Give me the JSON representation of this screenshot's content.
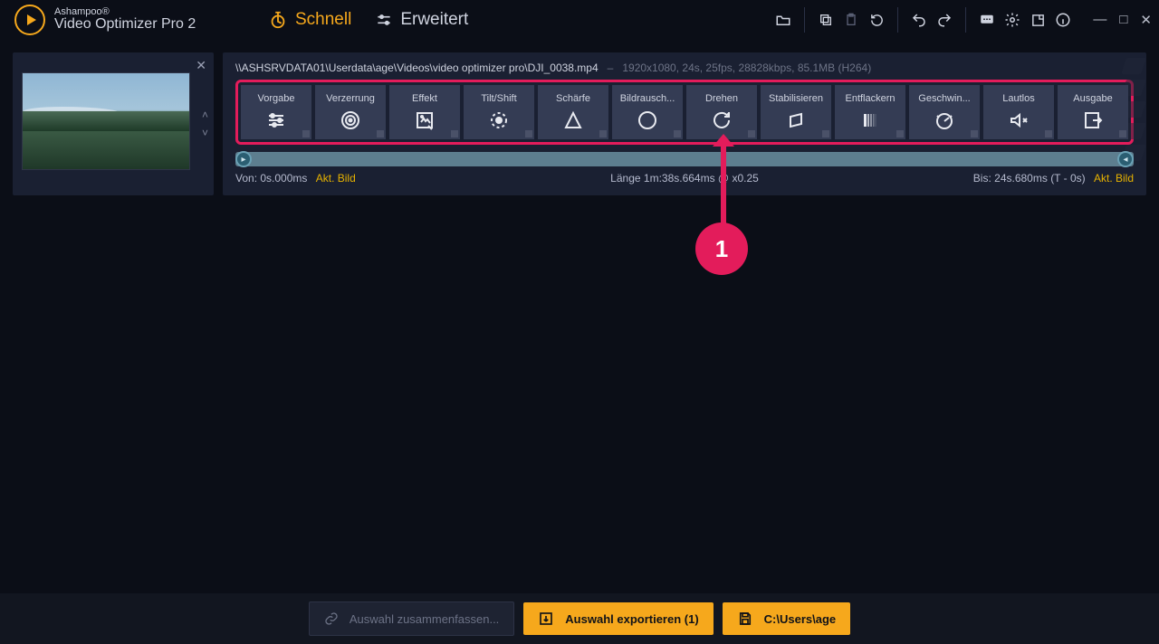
{
  "app": {
    "brand_small": "Ashampoo®",
    "brand_big": "Video Optimizer Pro 2"
  },
  "modes": {
    "fast": "Schnell",
    "advanced": "Erweitert"
  },
  "file": {
    "path": "\\\\ASHSRVDATA01\\Userdata\\age\\Videos\\video optimizer pro\\DJI_0038.mp4",
    "info": "1920x1080, 24s, 25fps, 28828kbps, 85.1MB (H264)"
  },
  "tools": [
    {
      "id": "vorgabe",
      "label": "Vorgabe"
    },
    {
      "id": "verzerrung",
      "label": "Verzerrung"
    },
    {
      "id": "effekt",
      "label": "Effekt"
    },
    {
      "id": "tiltshift",
      "label": "Tilt/Shift"
    },
    {
      "id": "schaerfe",
      "label": "Schärfe"
    },
    {
      "id": "bildrauschen",
      "label": "Bildrausch..."
    },
    {
      "id": "drehen",
      "label": "Drehen"
    },
    {
      "id": "stabilisieren",
      "label": "Stabilisieren"
    },
    {
      "id": "entflackern",
      "label": "Entflackern"
    },
    {
      "id": "geschwindigkeit",
      "label": "Geschwin..."
    },
    {
      "id": "lautlos",
      "label": "Lautlos"
    },
    {
      "id": "ausgabe",
      "label": "Ausgabe"
    }
  ],
  "timeline": {
    "from_label": "Von:",
    "from_value": "0s.000ms",
    "from_mark": "Akt. Bild",
    "length_label": "Länge",
    "length_value": "1m:38s.664ms @ x0.25",
    "to_label": "Bis:",
    "to_value": "24s.680ms (T - 0s)",
    "to_mark": "Akt. Bild"
  },
  "footer": {
    "merge_placeholder": "Auswahl zusammenfassen...",
    "export_label": "Auswahl exportieren (1)",
    "path_label": "C:\\Users\\age"
  },
  "annotation": {
    "badge": "1"
  }
}
